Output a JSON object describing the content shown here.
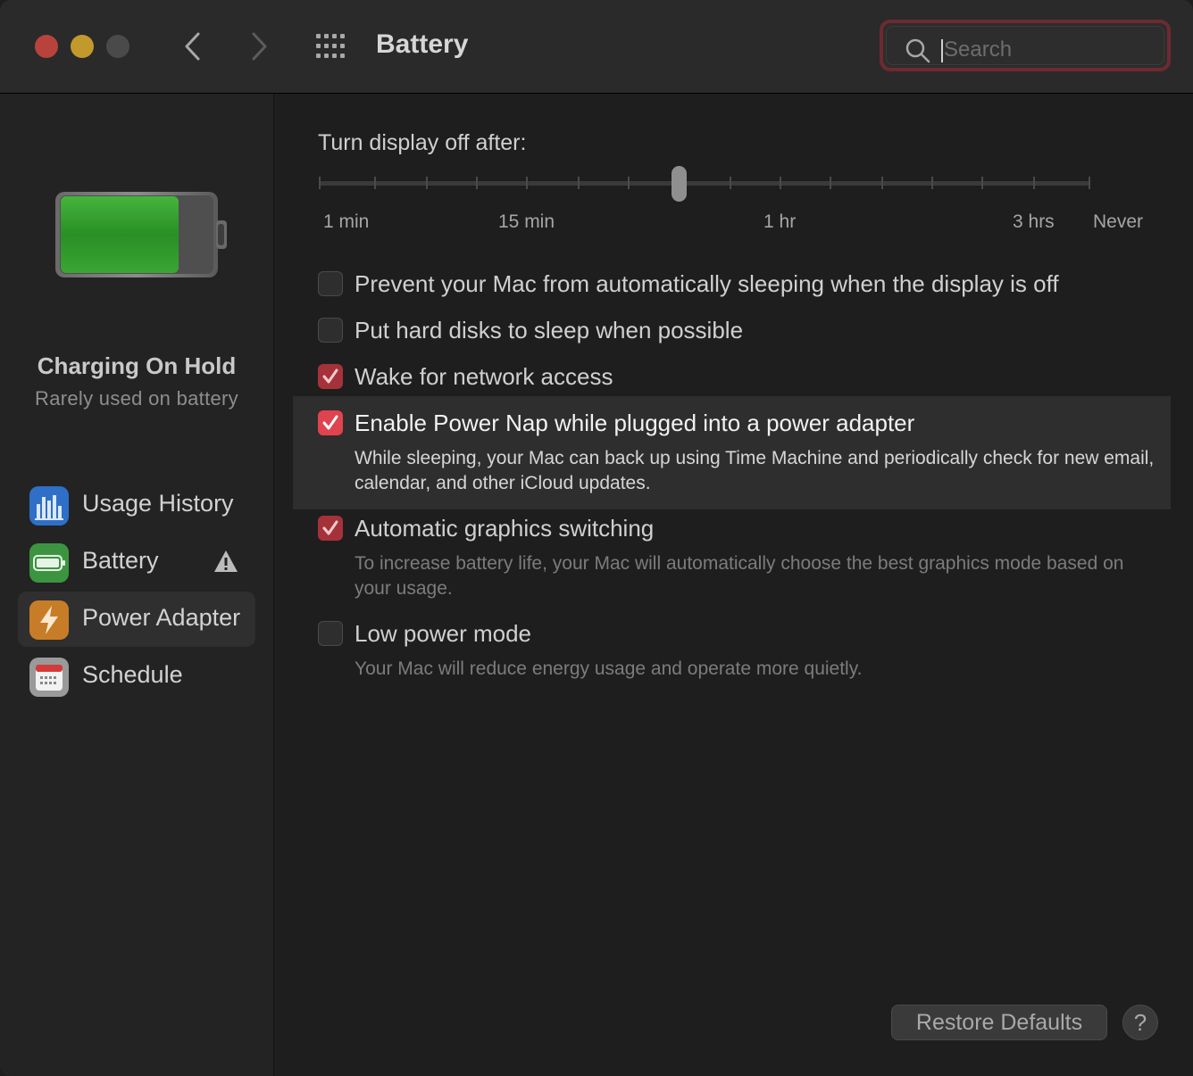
{
  "window": {
    "title": "Battery"
  },
  "search": {
    "placeholder": "Search",
    "value": ""
  },
  "toolbar": {
    "back_icon": "chevron-left-icon",
    "forward_icon": "chevron-right-icon",
    "grid_icon": "grid-icon"
  },
  "sidebar": {
    "status_title": "Charging On Hold",
    "status_subtitle": "Rarely used on battery",
    "items": [
      {
        "label": "Usage History",
        "icon": "bar-chart-icon",
        "color": "#2f6fc7",
        "selected": false
      },
      {
        "label": "Battery",
        "icon": "battery-icon",
        "color": "#3d9440",
        "selected": false,
        "warning": true
      },
      {
        "label": "Power Adapter",
        "icon": "lightning-icon",
        "color": "#c77d27",
        "selected": true
      },
      {
        "label": "Schedule",
        "icon": "calendar-icon",
        "color": "#9a9a9a",
        "selected": false
      }
    ]
  },
  "display_sleep": {
    "label": "Turn display off after:",
    "tick_labels": [
      "1 min",
      "15 min",
      "1 hr",
      "3 hrs",
      "Never"
    ],
    "current_position_fraction": 0.47
  },
  "options": [
    {
      "label": "Prevent your Mac from automatically sleeping when the display is off",
      "checked": false
    },
    {
      "label": "Put hard disks to sleep when possible",
      "checked": false
    },
    {
      "label": "Wake for network access",
      "checked": true
    },
    {
      "label": "Enable Power Nap while plugged into a power adapter",
      "checked": true,
      "highlighted": true,
      "description": "While sleeping, your Mac can back up using Time Machine and periodically check for new email, calendar, and other iCloud updates."
    },
    {
      "label": "Automatic graphics switching",
      "checked": true,
      "description": "To increase battery life, your Mac will automatically choose the best graphics mode based on your usage."
    },
    {
      "label": "Low power mode",
      "checked": false,
      "description": "Your Mac will reduce energy usage and operate more quietly."
    }
  ],
  "buttons": {
    "restore_defaults": "Restore Defaults",
    "help": "?"
  },
  "colors": {
    "accent": "#e0434e",
    "battery_fill": "#2f9b2f"
  }
}
